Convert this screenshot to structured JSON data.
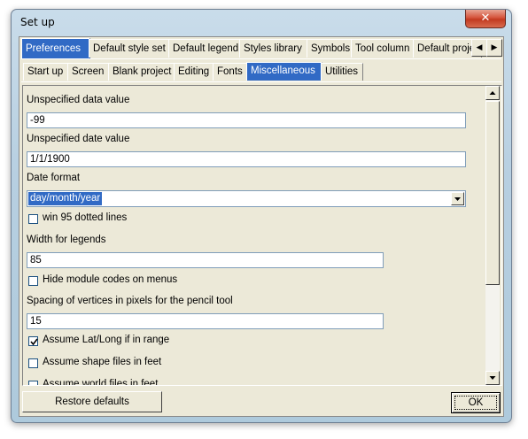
{
  "window": {
    "title": "Set up",
    "close_symbol": "✕"
  },
  "tabs_main": [
    {
      "label": "Preferences",
      "active": true
    },
    {
      "label": "Default style set",
      "active": false
    },
    {
      "label": "Default legend",
      "active": false
    },
    {
      "label": "Styles library",
      "active": false
    },
    {
      "label": "Symbols",
      "active": false
    },
    {
      "label": "Tool column",
      "active": false
    },
    {
      "label": "Default proje",
      "active": false
    }
  ],
  "tabs_sub": [
    {
      "label": "Start up",
      "active": false
    },
    {
      "label": "Screen",
      "active": false
    },
    {
      "label": "Blank project",
      "active": false
    },
    {
      "label": "Editing",
      "active": false
    },
    {
      "label": "Fonts",
      "active": false
    },
    {
      "label": "Miscellaneous",
      "active": true
    },
    {
      "label": "Utilities",
      "active": false
    }
  ],
  "form": {
    "unspecified_data_label": "Unspecified data value",
    "unspecified_data_value": "-99",
    "unspecified_date_label": "Unspecified date value",
    "unspecified_date_value": "1/1/1900",
    "date_format_label": "Date format",
    "date_format_value": "day/month/year",
    "win95_label": "win 95 dotted lines",
    "win95_checked": false,
    "legend_width_label": "Width for legends",
    "legend_width_value": "85",
    "hide_module_label": "Hide module codes on menus",
    "hide_module_checked": false,
    "pencil_spacing_label": "Spacing of vertices in pixels for the pencil tool",
    "pencil_spacing_value": "15",
    "latlong_label": "Assume Lat/Long if in range",
    "latlong_checked": true,
    "shape_feet_label": "Assume shape files in feet",
    "shape_feet_checked": false,
    "world_feet_label": "Assume world files in feet",
    "world_feet_checked": false
  },
  "buttons": {
    "restore": "Restore defaults",
    "ok": "OK"
  },
  "colors": {
    "selection": "#316ac5",
    "close": "#c23a20",
    "face": "#ece9d8"
  }
}
